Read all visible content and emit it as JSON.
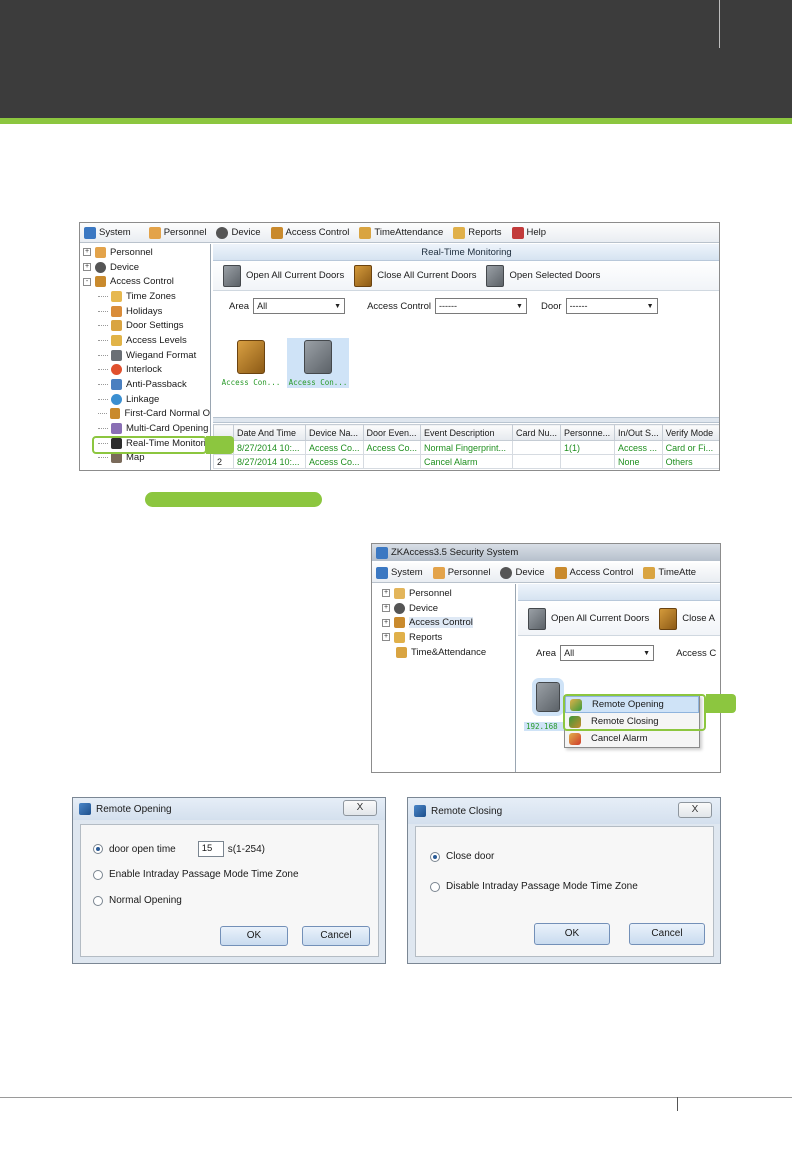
{
  "colors": {
    "header_band": "#3c3c3c",
    "accent_green": "#8cc63f",
    "event_text_green": "#1f8f1f"
  },
  "screenshot1": {
    "menu": [
      "System",
      "Personnel",
      "Device",
      "Access Control",
      "TimeAttendance",
      "Reports",
      "Help"
    ],
    "tree": {
      "top_nodes": [
        "Personnel",
        "Device",
        "Access Control"
      ],
      "children": [
        "Time Zones",
        "Holidays",
        "Door Settings",
        "Access Levels",
        "Wiegand Format",
        "Interlock",
        "Anti-Passback",
        "Linkage",
        "First-Card Normal O",
        "Multi-Card Opening",
        "Real-Time Monitori",
        "Map"
      ]
    },
    "panel_title": "Real-Time Monitoring",
    "toolbar": [
      "Open All Current Doors",
      "Close All Current Doors",
      "Open Selected Doors"
    ],
    "filters": {
      "area_label": "Area",
      "area_value": "All",
      "access_label": "Access Control",
      "access_value": "------",
      "door_label": "Door",
      "door_value": "------"
    },
    "devices": [
      "Access Con...",
      "Access Con..."
    ],
    "table": {
      "columns": [
        "",
        "Date And Time",
        "Device Na...",
        "Door Even...",
        "Event Description",
        "Card Nu...",
        "Personne...",
        "In/Out S...",
        "Verify Mode"
      ],
      "rows": [
        [
          "",
          "8/27/2014 10:...",
          "Access Co...",
          "Access Co...",
          "Normal Fingerprint...",
          "",
          "1(1)",
          "Access ...",
          "Card or Fi..."
        ],
        [
          "2",
          "8/27/2014 10:...",
          "Access Co...",
          "",
          "Cancel Alarm",
          "",
          "",
          "None",
          "Others"
        ]
      ]
    }
  },
  "screenshot2": {
    "title": "ZKAccess3.5 Security System",
    "menu": [
      "System",
      "Personnel",
      "Device",
      "Access Control",
      "TimeAtte"
    ],
    "tree": [
      "Personnel",
      "Device",
      "Access Control",
      "Reports",
      "Time&Attendance"
    ],
    "toolbar": [
      "Open All Current Doors",
      "Close A"
    ],
    "area_label": "Area",
    "area_value": "All",
    "access_label": "Access C",
    "device_label": "192.168",
    "context_menu": [
      "Remote Opening",
      "Remote Closing",
      "Cancel Alarm"
    ]
  },
  "dialog_open": {
    "title": "Remote Opening",
    "option1": "door open time",
    "value": "15",
    "unit": "s(1-254)",
    "option2": "Enable Intraday Passage Mode Time Zone",
    "option3": "Normal Opening",
    "ok": "OK",
    "cancel": "Cancel",
    "close": "X"
  },
  "dialog_close": {
    "title": "Remote Closing",
    "option1": "Close door",
    "option2": "Disable Intraday Passage Mode Time Zone",
    "ok": "OK",
    "cancel": "Cancel",
    "close": "X"
  }
}
